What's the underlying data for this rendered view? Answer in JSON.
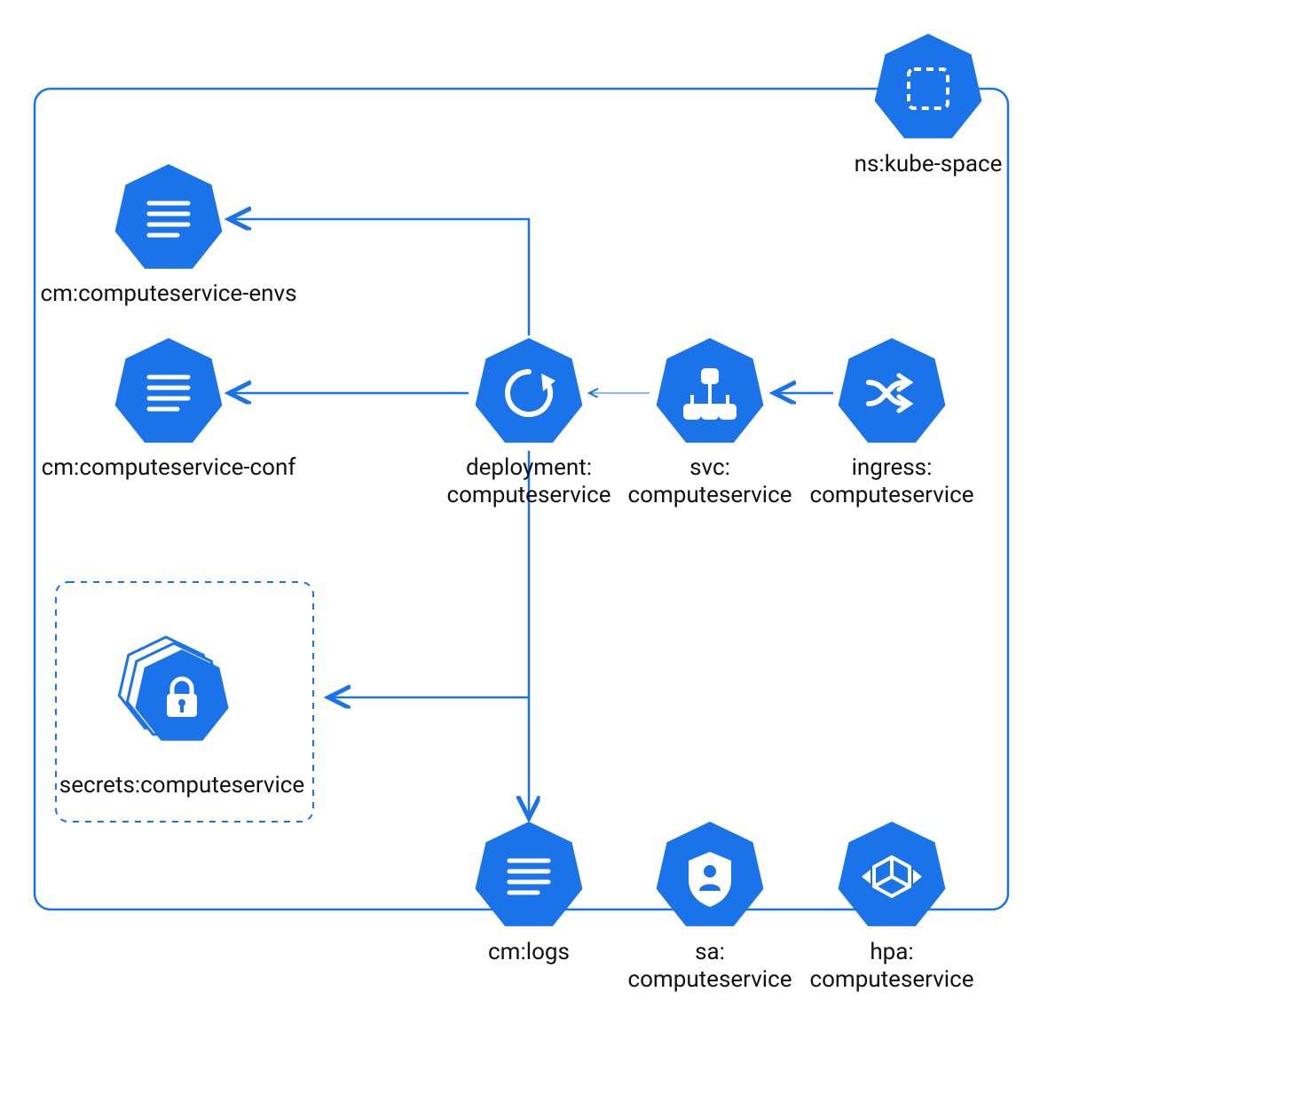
{
  "diagram": {
    "namespace": {
      "label": "ns:kube-space",
      "icon": "namespace-icon"
    },
    "nodes": {
      "cm_envs": {
        "label": "cm:computeservice-envs",
        "icon": "configmap-icon"
      },
      "cm_conf": {
        "label": "cm:computeservice-conf",
        "icon": "configmap-icon"
      },
      "secrets": {
        "label": "secrets:computeservice",
        "icon": "secret-icon"
      },
      "deployment": {
        "label": "deployment:\ncomputeservice",
        "icon": "deployment-icon"
      },
      "svc": {
        "label": "svc:\ncomputeservice",
        "icon": "service-icon"
      },
      "ingress": {
        "label": "ingress:\ncomputeservice",
        "icon": "ingress-icon"
      },
      "cm_logs": {
        "label": "cm:logs",
        "icon": "configmap-icon"
      },
      "sa": {
        "label": "sa:\ncomputeservice",
        "icon": "serviceaccount-icon"
      },
      "hpa": {
        "label": "hpa:\ncomputeservice",
        "icon": "hpa-icon"
      }
    },
    "edges": [
      {
        "from": "ingress",
        "to": "svc"
      },
      {
        "from": "svc",
        "to": "deployment"
      },
      {
        "from": "deployment",
        "to": "cm_envs"
      },
      {
        "from": "deployment",
        "to": "cm_conf"
      },
      {
        "from": "deployment",
        "to": "secrets"
      },
      {
        "from": "deployment",
        "to": "cm_logs"
      }
    ],
    "colors": {
      "accent": "#1a73e8"
    }
  }
}
